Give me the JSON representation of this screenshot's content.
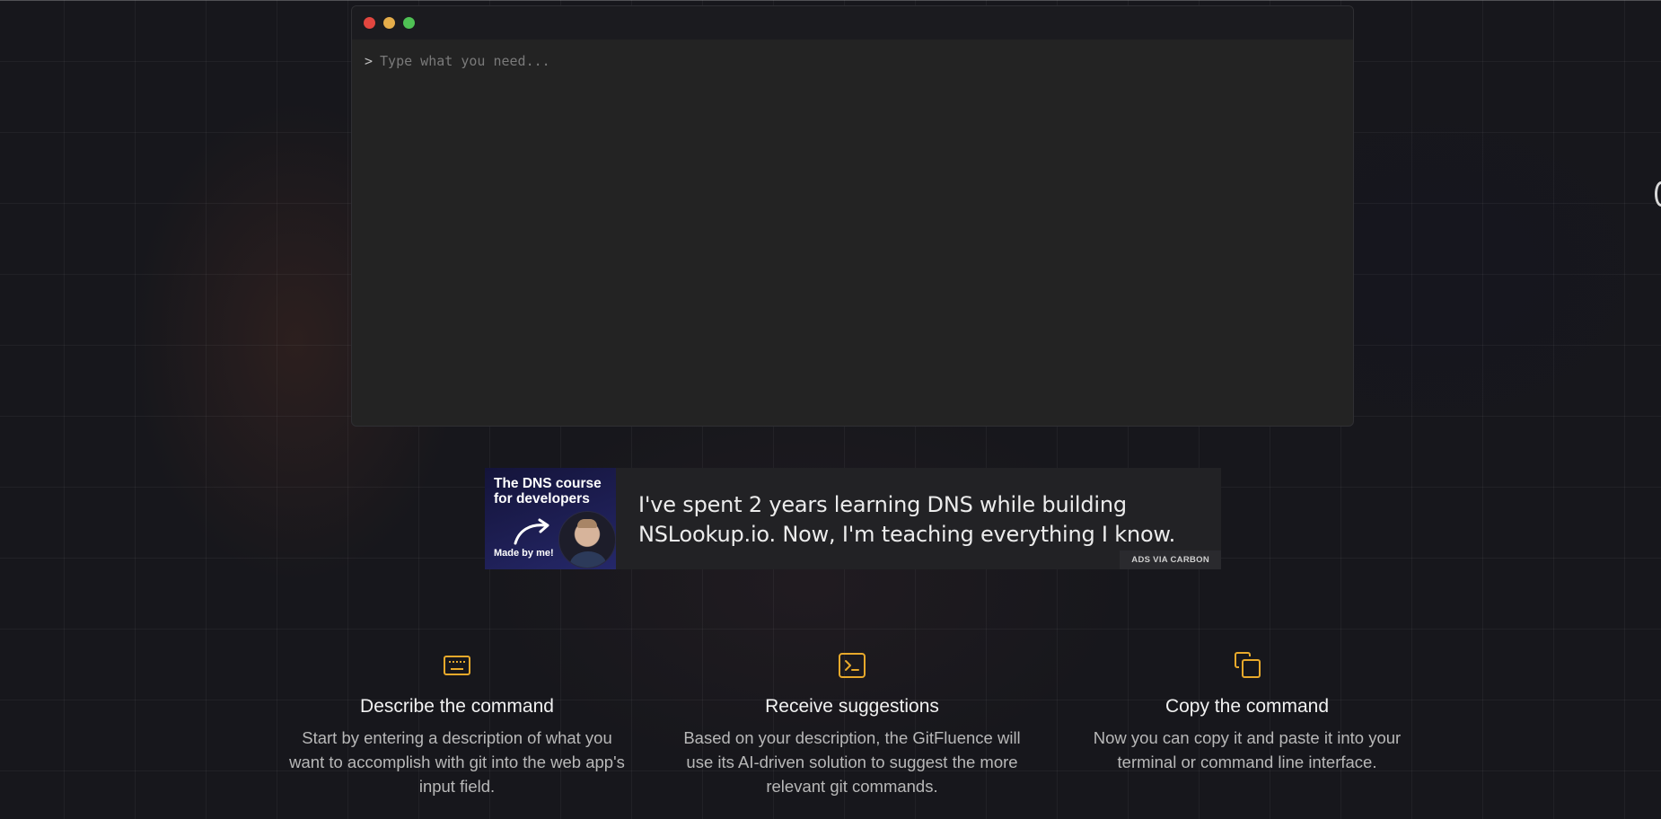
{
  "terminal": {
    "prompt_symbol": ">",
    "input_placeholder": "Type what you need...",
    "input_value": ""
  },
  "ad": {
    "image_title": "The DNS course for developers",
    "image_caption": "Made by me!",
    "text": "I've spent 2 years learning DNS while building NSLookup.io. Now, I'm teaching everything I know.",
    "attribution": "ADS VIA CARBON"
  },
  "features": [
    {
      "icon": "keyboard-icon",
      "title": "Describe the command",
      "description": "Start by entering a description of what you want to accomplish with git into the web app's input field."
    },
    {
      "icon": "terminal-icon",
      "title": "Receive suggestions",
      "description": "Based on your description, the GitFluence will use its AI-driven solution to suggest the more relevant git commands."
    },
    {
      "icon": "copy-icon",
      "title": "Copy the command",
      "description": "Now you can copy it and paste it into your terminal or command line interface."
    }
  ],
  "colors": {
    "page_background": "#17171c",
    "terminal_background": "#232323",
    "accent_icon": "#e8a92b",
    "window_close": "#e2463f",
    "window_minimize": "#e5ad4a",
    "window_maximize": "#4fc154"
  }
}
